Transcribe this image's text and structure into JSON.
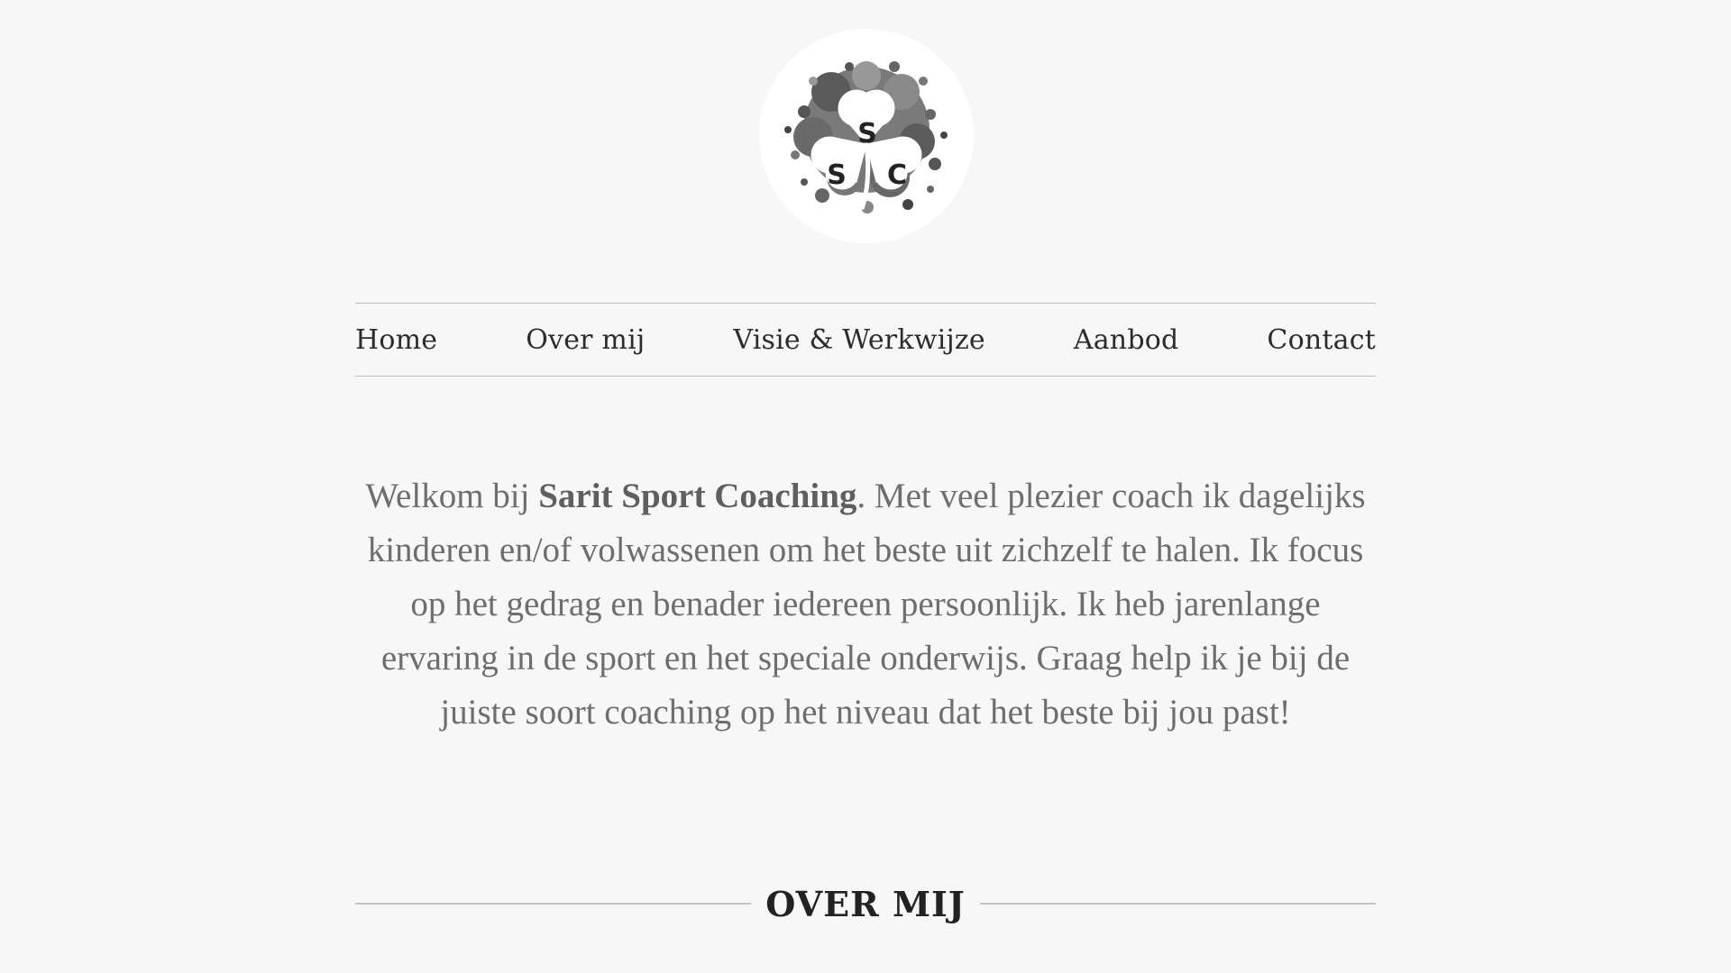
{
  "logo": {
    "letters": [
      "S",
      "S",
      "C"
    ],
    "icon": "shamrock-splash-logo"
  },
  "nav": {
    "items": [
      {
        "label": "Home"
      },
      {
        "label": "Over mij"
      },
      {
        "label": "Visie & Werkwijze"
      },
      {
        "label": "Aanbod"
      },
      {
        "label": "Contact"
      }
    ]
  },
  "intro": {
    "prefix": "Welkom bij ",
    "brand": "Sarit Sport Coaching",
    "body": ". Met veel plezier coach ik dagelijks kinderen en/of volwassenen om het beste uit zichzelf te halen. Ik focus op het gedrag en benader iedereen persoonlijk. Ik heb jarenlange ervaring in de sport en het speciale onderwijs. Graag help ik je bij de juiste soort coaching op het niveau dat het beste bij jou past!"
  },
  "section": {
    "heading": "OVER MIJ"
  },
  "colors": {
    "background": "#f7f7f7",
    "text": "#6e6e6e",
    "nav_text": "#2c2c2c",
    "heading": "#222222",
    "rule": "#bdbdbd"
  }
}
